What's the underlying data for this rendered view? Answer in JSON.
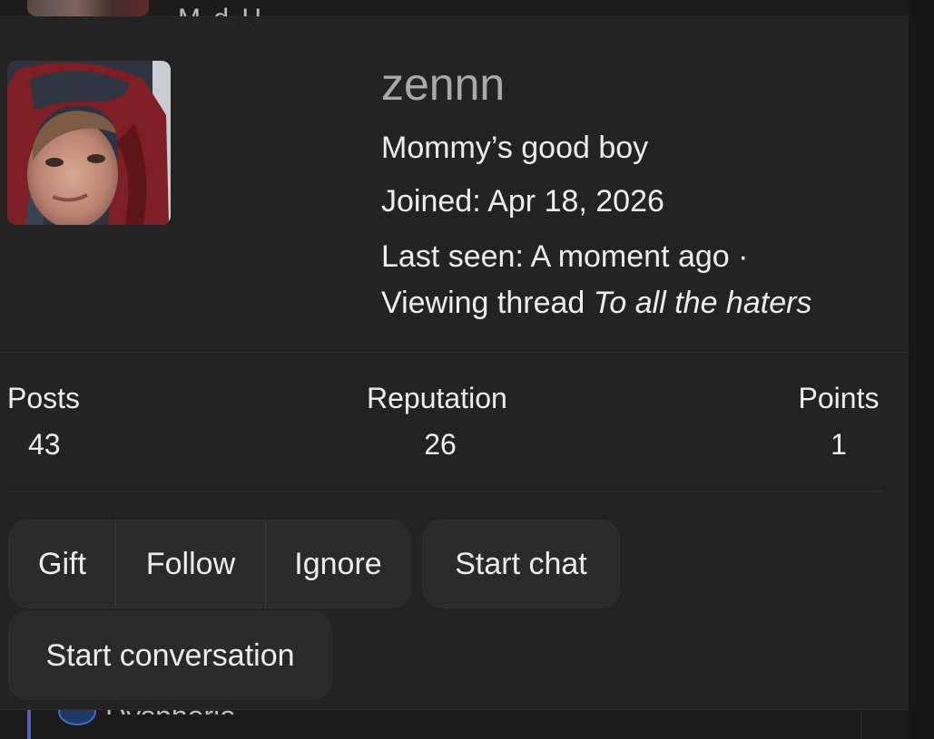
{
  "background": {
    "top_text_fragment": "M    d    H",
    "bottom_text_fragment": "Dysphoria"
  },
  "profile": {
    "username": "zennn",
    "user_title": "Mommy’s good boy",
    "joined": "Joined: Apr 18, 2026",
    "last_seen": "Last seen: A moment ago ·",
    "activity_prefix": "Viewing thread ",
    "activity_thread": "To all the haters"
  },
  "stats": {
    "posts": {
      "label": "Posts",
      "value": "43"
    },
    "reputation": {
      "label": "Reputation",
      "value": "26"
    },
    "points": {
      "label": "Points",
      "value": "1"
    }
  },
  "actions": {
    "gift": "Gift",
    "follow": "Follow",
    "ignore": "Ignore",
    "start_chat": "Start chat",
    "start_conversation": "Start conversation"
  },
  "colors": {
    "card_background": "#232323",
    "page_background": "#1b1b1b",
    "button_background": "#2a2a2a",
    "username_color": "#a9a9a9",
    "text_color": "#eeeeee"
  }
}
